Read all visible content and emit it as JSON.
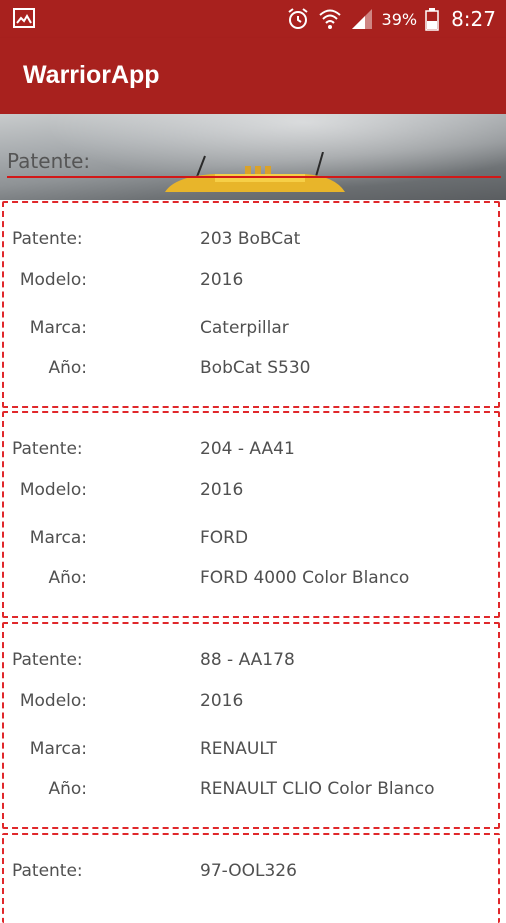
{
  "status_bar": {
    "battery_percent": "39%",
    "time": "8:27",
    "icons": [
      "gallery-icon",
      "alarm-icon",
      "wifi-icon",
      "signal-icon",
      "battery-icon"
    ]
  },
  "app_bar": {
    "title": "WarriorApp"
  },
  "search": {
    "placeholder": "Patente:"
  },
  "labels": {
    "patente": "Patente:",
    "modelo": "Modelo:",
    "marca": "Marca:",
    "anio": "Año:"
  },
  "vehicles": [
    {
      "patente": "203 BoBCat",
      "modelo": "2016",
      "marca": "Caterpillar",
      "anio": "BobCat S530"
    },
    {
      "patente": "204 - AA41",
      "modelo": "2016",
      "marca": "FORD",
      "anio": "FORD 4000 Color Blanco"
    },
    {
      "patente": "88 - AA178",
      "modelo": "2016",
      "marca": "RENAULT",
      "anio": "RENAULT CLIO Color Blanco"
    },
    {
      "patente": "97-OOL326"
    }
  ],
  "colors": {
    "primary": "#a8211e",
    "accent": "#d21818",
    "card_border": "#e0282b"
  }
}
